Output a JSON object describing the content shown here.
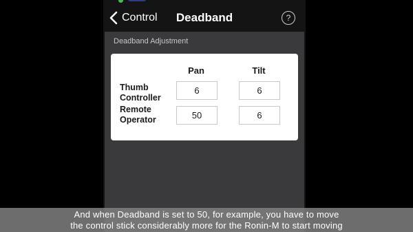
{
  "navbar": {
    "back_label": "Control",
    "title": "Deadband",
    "help_symbol": "?"
  },
  "section": {
    "header": "Deadband Adjustment"
  },
  "table": {
    "columns": [
      "Pan",
      "Tilt"
    ],
    "rows": [
      {
        "label_line1": "Thumb",
        "label_line2": "Controller",
        "pan": "6",
        "tilt": "6"
      },
      {
        "label_line1": "Remote",
        "label_line2": "Operator",
        "pan": "50",
        "tilt": "6"
      }
    ]
  },
  "subtitle": {
    "line1": "And when Deadband is set to 50, for example, you have to move",
    "line2": "the control stick considerably more for the Ronin-M to start moving"
  },
  "colors": {
    "background": "#000000",
    "panel": "#3a3a3d",
    "card": "#ffffff",
    "status_green": "#3fbf4a"
  },
  "icons": {
    "back": "chevron-left-icon",
    "help": "question-circle-icon"
  }
}
